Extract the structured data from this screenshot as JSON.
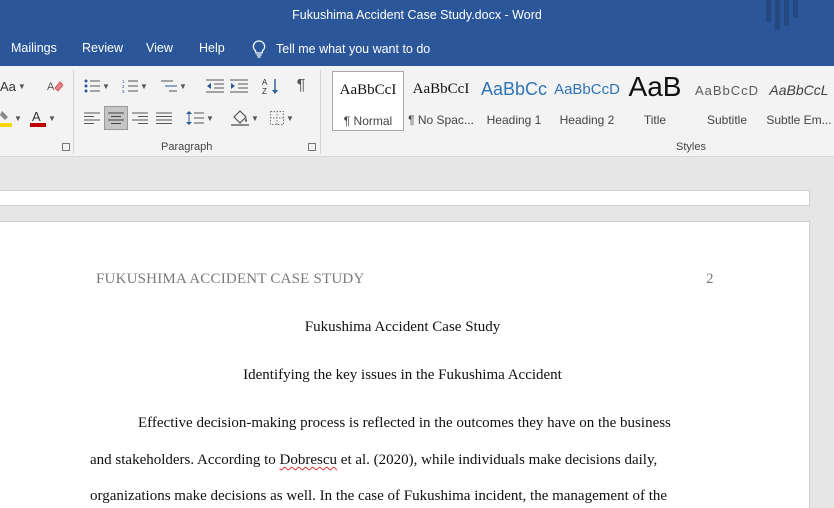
{
  "window": {
    "title": "Fukushima Accident Case Study.docx  -  Word"
  },
  "ribbon_tabs": [
    "Mailings",
    "Review",
    "View",
    "Help"
  ],
  "tell_me": {
    "text": "Tell me what you want to do"
  },
  "font_group": {
    "change_case_label": "Aa",
    "font_color": "#c00000",
    "highlight_color": "#ffd700"
  },
  "paragraph_group": {
    "label": "Paragraph"
  },
  "styles_group": {
    "label": "Styles",
    "items": [
      {
        "preview": "AaBbCcI",
        "name": "¶ Normal",
        "selected": true
      },
      {
        "preview": "AaBbCcI",
        "name": "¶ No Spac..."
      },
      {
        "preview": "AaBbCc",
        "name": "Heading 1"
      },
      {
        "preview": "AaBbCcD",
        "name": "Heading 2"
      },
      {
        "preview": "AaB",
        "name": "Title"
      },
      {
        "preview": "AaBbCcD",
        "name": "Subtitle"
      },
      {
        "preview": "AaBbCcL",
        "name": "Subtle Em..."
      }
    ]
  },
  "document": {
    "running_head": "FUKUSHIMA ACCIDENT CASE STUDY",
    "page_number": "2",
    "title": "Fukushima Accident Case Study",
    "heading": "Identifying the key issues in the Fukushima Accident",
    "line1": "Effective decision-making process is reflected in the outcomes they have on the business",
    "line2_pre": "and stakeholders. According to ",
    "line2_err": "Dobrescu",
    "line2_post": " et al. (2020), while individuals make decisions daily,",
    "line3": "organizations make decisions as well. In the case of Fukushima incident, the management of the"
  }
}
